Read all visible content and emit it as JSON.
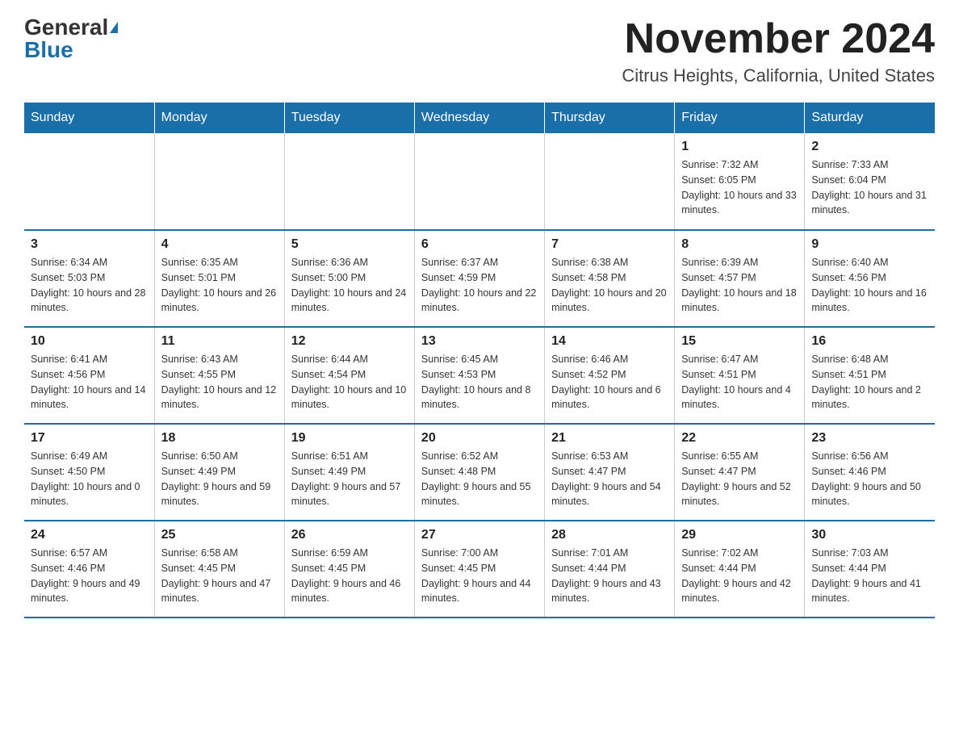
{
  "logo": {
    "general": "General",
    "blue": "Blue"
  },
  "title": "November 2024",
  "subtitle": "Citrus Heights, California, United States",
  "days_of_week": [
    "Sunday",
    "Monday",
    "Tuesday",
    "Wednesday",
    "Thursday",
    "Friday",
    "Saturday"
  ],
  "weeks": [
    [
      {
        "day": "",
        "info": ""
      },
      {
        "day": "",
        "info": ""
      },
      {
        "day": "",
        "info": ""
      },
      {
        "day": "",
        "info": ""
      },
      {
        "day": "",
        "info": ""
      },
      {
        "day": "1",
        "info": "Sunrise: 7:32 AM\nSunset: 6:05 PM\nDaylight: 10 hours and 33 minutes."
      },
      {
        "day": "2",
        "info": "Sunrise: 7:33 AM\nSunset: 6:04 PM\nDaylight: 10 hours and 31 minutes."
      }
    ],
    [
      {
        "day": "3",
        "info": "Sunrise: 6:34 AM\nSunset: 5:03 PM\nDaylight: 10 hours and 28 minutes."
      },
      {
        "day": "4",
        "info": "Sunrise: 6:35 AM\nSunset: 5:01 PM\nDaylight: 10 hours and 26 minutes."
      },
      {
        "day": "5",
        "info": "Sunrise: 6:36 AM\nSunset: 5:00 PM\nDaylight: 10 hours and 24 minutes."
      },
      {
        "day": "6",
        "info": "Sunrise: 6:37 AM\nSunset: 4:59 PM\nDaylight: 10 hours and 22 minutes."
      },
      {
        "day": "7",
        "info": "Sunrise: 6:38 AM\nSunset: 4:58 PM\nDaylight: 10 hours and 20 minutes."
      },
      {
        "day": "8",
        "info": "Sunrise: 6:39 AM\nSunset: 4:57 PM\nDaylight: 10 hours and 18 minutes."
      },
      {
        "day": "9",
        "info": "Sunrise: 6:40 AM\nSunset: 4:56 PM\nDaylight: 10 hours and 16 minutes."
      }
    ],
    [
      {
        "day": "10",
        "info": "Sunrise: 6:41 AM\nSunset: 4:56 PM\nDaylight: 10 hours and 14 minutes."
      },
      {
        "day": "11",
        "info": "Sunrise: 6:43 AM\nSunset: 4:55 PM\nDaylight: 10 hours and 12 minutes."
      },
      {
        "day": "12",
        "info": "Sunrise: 6:44 AM\nSunset: 4:54 PM\nDaylight: 10 hours and 10 minutes."
      },
      {
        "day": "13",
        "info": "Sunrise: 6:45 AM\nSunset: 4:53 PM\nDaylight: 10 hours and 8 minutes."
      },
      {
        "day": "14",
        "info": "Sunrise: 6:46 AM\nSunset: 4:52 PM\nDaylight: 10 hours and 6 minutes."
      },
      {
        "day": "15",
        "info": "Sunrise: 6:47 AM\nSunset: 4:51 PM\nDaylight: 10 hours and 4 minutes."
      },
      {
        "day": "16",
        "info": "Sunrise: 6:48 AM\nSunset: 4:51 PM\nDaylight: 10 hours and 2 minutes."
      }
    ],
    [
      {
        "day": "17",
        "info": "Sunrise: 6:49 AM\nSunset: 4:50 PM\nDaylight: 10 hours and 0 minutes."
      },
      {
        "day": "18",
        "info": "Sunrise: 6:50 AM\nSunset: 4:49 PM\nDaylight: 9 hours and 59 minutes."
      },
      {
        "day": "19",
        "info": "Sunrise: 6:51 AM\nSunset: 4:49 PM\nDaylight: 9 hours and 57 minutes."
      },
      {
        "day": "20",
        "info": "Sunrise: 6:52 AM\nSunset: 4:48 PM\nDaylight: 9 hours and 55 minutes."
      },
      {
        "day": "21",
        "info": "Sunrise: 6:53 AM\nSunset: 4:47 PM\nDaylight: 9 hours and 54 minutes."
      },
      {
        "day": "22",
        "info": "Sunrise: 6:55 AM\nSunset: 4:47 PM\nDaylight: 9 hours and 52 minutes."
      },
      {
        "day": "23",
        "info": "Sunrise: 6:56 AM\nSunset: 4:46 PM\nDaylight: 9 hours and 50 minutes."
      }
    ],
    [
      {
        "day": "24",
        "info": "Sunrise: 6:57 AM\nSunset: 4:46 PM\nDaylight: 9 hours and 49 minutes."
      },
      {
        "day": "25",
        "info": "Sunrise: 6:58 AM\nSunset: 4:45 PM\nDaylight: 9 hours and 47 minutes."
      },
      {
        "day": "26",
        "info": "Sunrise: 6:59 AM\nSunset: 4:45 PM\nDaylight: 9 hours and 46 minutes."
      },
      {
        "day": "27",
        "info": "Sunrise: 7:00 AM\nSunset: 4:45 PM\nDaylight: 9 hours and 44 minutes."
      },
      {
        "day": "28",
        "info": "Sunrise: 7:01 AM\nSunset: 4:44 PM\nDaylight: 9 hours and 43 minutes."
      },
      {
        "day": "29",
        "info": "Sunrise: 7:02 AM\nSunset: 4:44 PM\nDaylight: 9 hours and 42 minutes."
      },
      {
        "day": "30",
        "info": "Sunrise: 7:03 AM\nSunset: 4:44 PM\nDaylight: 9 hours and 41 minutes."
      }
    ]
  ]
}
